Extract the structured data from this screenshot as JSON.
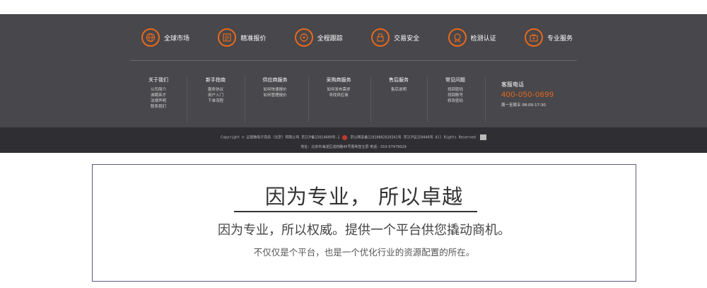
{
  "features": [
    {
      "icon": "globe-icon",
      "label": "全球市场"
    },
    {
      "icon": "report-icon",
      "label": "精准报价"
    },
    {
      "icon": "track-icon",
      "label": "全程跟踪"
    },
    {
      "icon": "lock-icon",
      "label": "交易安全"
    },
    {
      "icon": "badge-icon",
      "label": "检测认证"
    },
    {
      "icon": "briefcase-icon",
      "label": "专业服务"
    }
  ],
  "columns": [
    {
      "title": "关于我们",
      "links": [
        "公司简介",
        "诚聘英才",
        "法律声明",
        "联系我们"
      ]
    },
    {
      "title": "新手指南",
      "links": [
        "服务协议",
        "用户入门",
        "下单流程"
      ]
    },
    {
      "title": "供应商服务",
      "links": [
        "如何快速报价",
        "如何管理报价"
      ]
    },
    {
      "title": "采购商服务",
      "links": [
        "如何发布需求",
        "寻找供应商"
      ]
    },
    {
      "title": "售后服务",
      "links": [
        "售后说明"
      ]
    },
    {
      "title": "常见问题",
      "links": [
        "找回密码",
        "找回账号",
        "修改密码"
      ]
    }
  ],
  "hotline": {
    "title": "客服电话",
    "number": "400-050-0699",
    "hours": "周一至周五 08:00-17:30"
  },
  "copyright": {
    "line1a": "Copyright © 云智融电子商务（北京）有限公司  京ICP备15014609号-1",
    "line1b": "京公网安备11010802020341号  京ICP证150446号 All Rights Reserved",
    "line2": "地址：北京市海淀区成府路45号惠希智五层    电话：010-57479029"
  },
  "slogan": {
    "title": "因为专业，  所以卓越",
    "sub": "因为专业，所以权威。提供一个平台供您撬动商机。",
    "sub2": "不仅仅是个平台，也是一个优化行业的资源配置的所在。"
  },
  "colors": {
    "accent": "#e8691c",
    "footer_bg": "#48474b",
    "copybar_bg": "#2f2f33"
  }
}
